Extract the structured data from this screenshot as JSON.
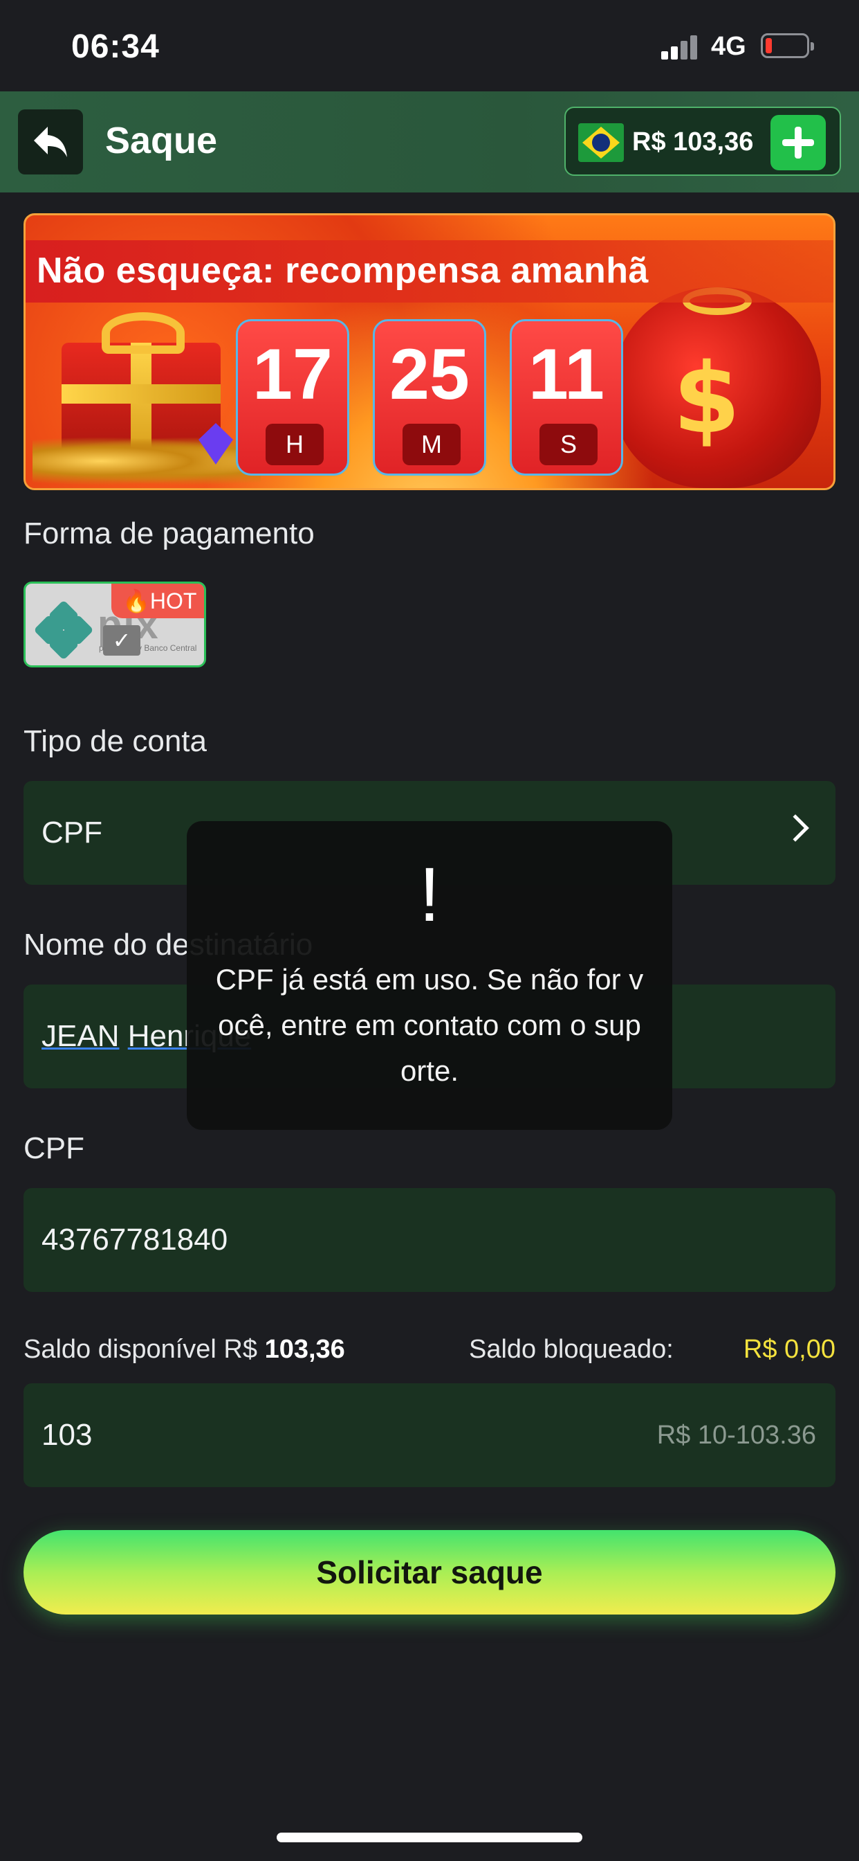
{
  "status_bar": {
    "time": "06:34",
    "network": "4G"
  },
  "header": {
    "title": "Saque",
    "balance": "R$ 103,36"
  },
  "banner": {
    "title": "Não esqueça: recompensa amanhã",
    "countdown": [
      {
        "value": "17",
        "unit": "H"
      },
      {
        "value": "25",
        "unit": "M"
      },
      {
        "value": "11",
        "unit": "S"
      }
    ]
  },
  "payment": {
    "label": "Forma de pagamento",
    "method_logo": "pix",
    "method_subtitle": "powered by Banco Central",
    "badge": "HOT"
  },
  "account_type": {
    "label": "Tipo de conta",
    "value": "CPF"
  },
  "recipient": {
    "label": "Nome do destinatário",
    "value_first": "JEAN",
    "value_second": "Henrique"
  },
  "cpf": {
    "label": "CPF",
    "value": "43767781840"
  },
  "balances": {
    "available_label": "Saldo disponível R$",
    "available_value": "103,36",
    "blocked_label": "Saldo bloqueado:",
    "blocked_value": "R$ 0,00"
  },
  "amount": {
    "value": "103",
    "hint": "R$ 10-103.36"
  },
  "submit": {
    "label": "Solicitar saque"
  },
  "toast": {
    "icon": "!",
    "message": "CPF já está em uso. Se não for você, entre em contato com o suporte."
  },
  "colors": {
    "accent_green": "#22c04a",
    "field_bg": "#1a3221",
    "blocked_yellow": "#f4e23e"
  }
}
